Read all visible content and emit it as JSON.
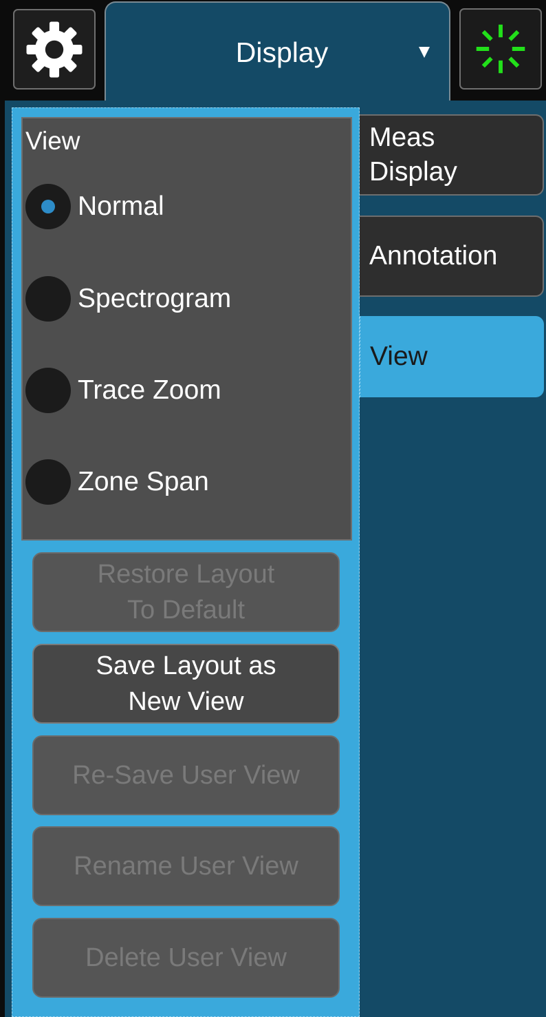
{
  "header": {
    "menu_title": "Display",
    "settings_icon": "gear-icon",
    "dropdown_icon": "triangle-down-icon",
    "status_icon": "busy-spinner-icon"
  },
  "view_group": {
    "title": "View",
    "options": [
      {
        "label": "Normal",
        "selected": true
      },
      {
        "label": "Spectrogram",
        "selected": false
      },
      {
        "label": "Trace Zoom",
        "selected": false
      },
      {
        "label": "Zone Span",
        "selected": false
      }
    ]
  },
  "actions": {
    "restore_default": "Restore Layout\nTo Default",
    "save_new_view": "Save Layout as\nNew View",
    "resave_user_view": "Re-Save User View",
    "rename_user_view": "Rename User View",
    "delete_user_view": "Delete User View"
  },
  "side_tabs": [
    {
      "label": "Meas\nDisplay",
      "active": false
    },
    {
      "label": "Annotation",
      "active": false
    },
    {
      "label": "View",
      "active": true
    }
  ],
  "colors": {
    "panel_bg": "#144a66",
    "active_blue": "#3aa9dc",
    "spinner_green": "#22e01a",
    "radio_selected": "#2d8cc8",
    "disabled_text": "#7a7a7a"
  }
}
